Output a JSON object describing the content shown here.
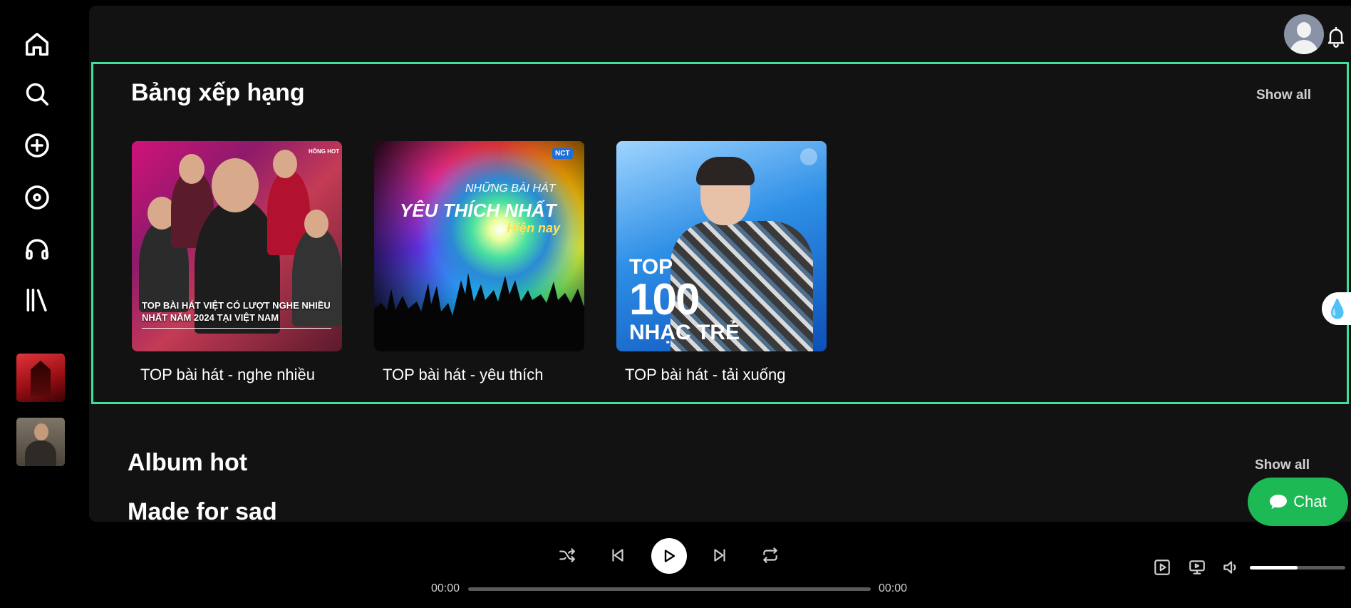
{
  "sidebar": {
    "icons": [
      "home-icon",
      "search-icon",
      "plus-circle-icon",
      "disc-icon",
      "headphones-icon",
      "library-icon"
    ]
  },
  "header": {
    "notification_icon": "bell-icon"
  },
  "charts_section": {
    "title": "Bảng xếp hạng",
    "show_all": "Show all",
    "cards": [
      {
        "title": "TOP bài hát - nghe nhiều",
        "cover_caption": "TOP BÀI HÁT VIỆT CÓ LƯỢT NGHE NHIỀU NHẤT NĂM 2024 TẠI VIỆT NAM",
        "cover_tag": "HỒNG HOT"
      },
      {
        "title": "TOP bài hát - yêu thích",
        "cover_line1": "NHỮNG BÀI HÁT",
        "cover_line2": "YÊU THÍCH NHẤT",
        "cover_line3": "Hiện nay",
        "cover_badge": "NCT"
      },
      {
        "title": "TOP bài hát - tải xuống",
        "cover_line1": "TOP",
        "cover_line2": "100",
        "cover_line3": "NHẠC TRẺ"
      }
    ]
  },
  "album_section": {
    "title": "Album hot",
    "show_all": "Show all"
  },
  "sad_section": {
    "title": "Made for sad"
  },
  "chat": {
    "label": "Chat"
  },
  "player": {
    "current_time": "00:00",
    "total_time": "00:00",
    "progress": 0,
    "volume": 0.5
  },
  "colors": {
    "accent": "#1db954",
    "highlight_border": "#3fe19a",
    "panel": "#121212",
    "background": "#000000"
  }
}
